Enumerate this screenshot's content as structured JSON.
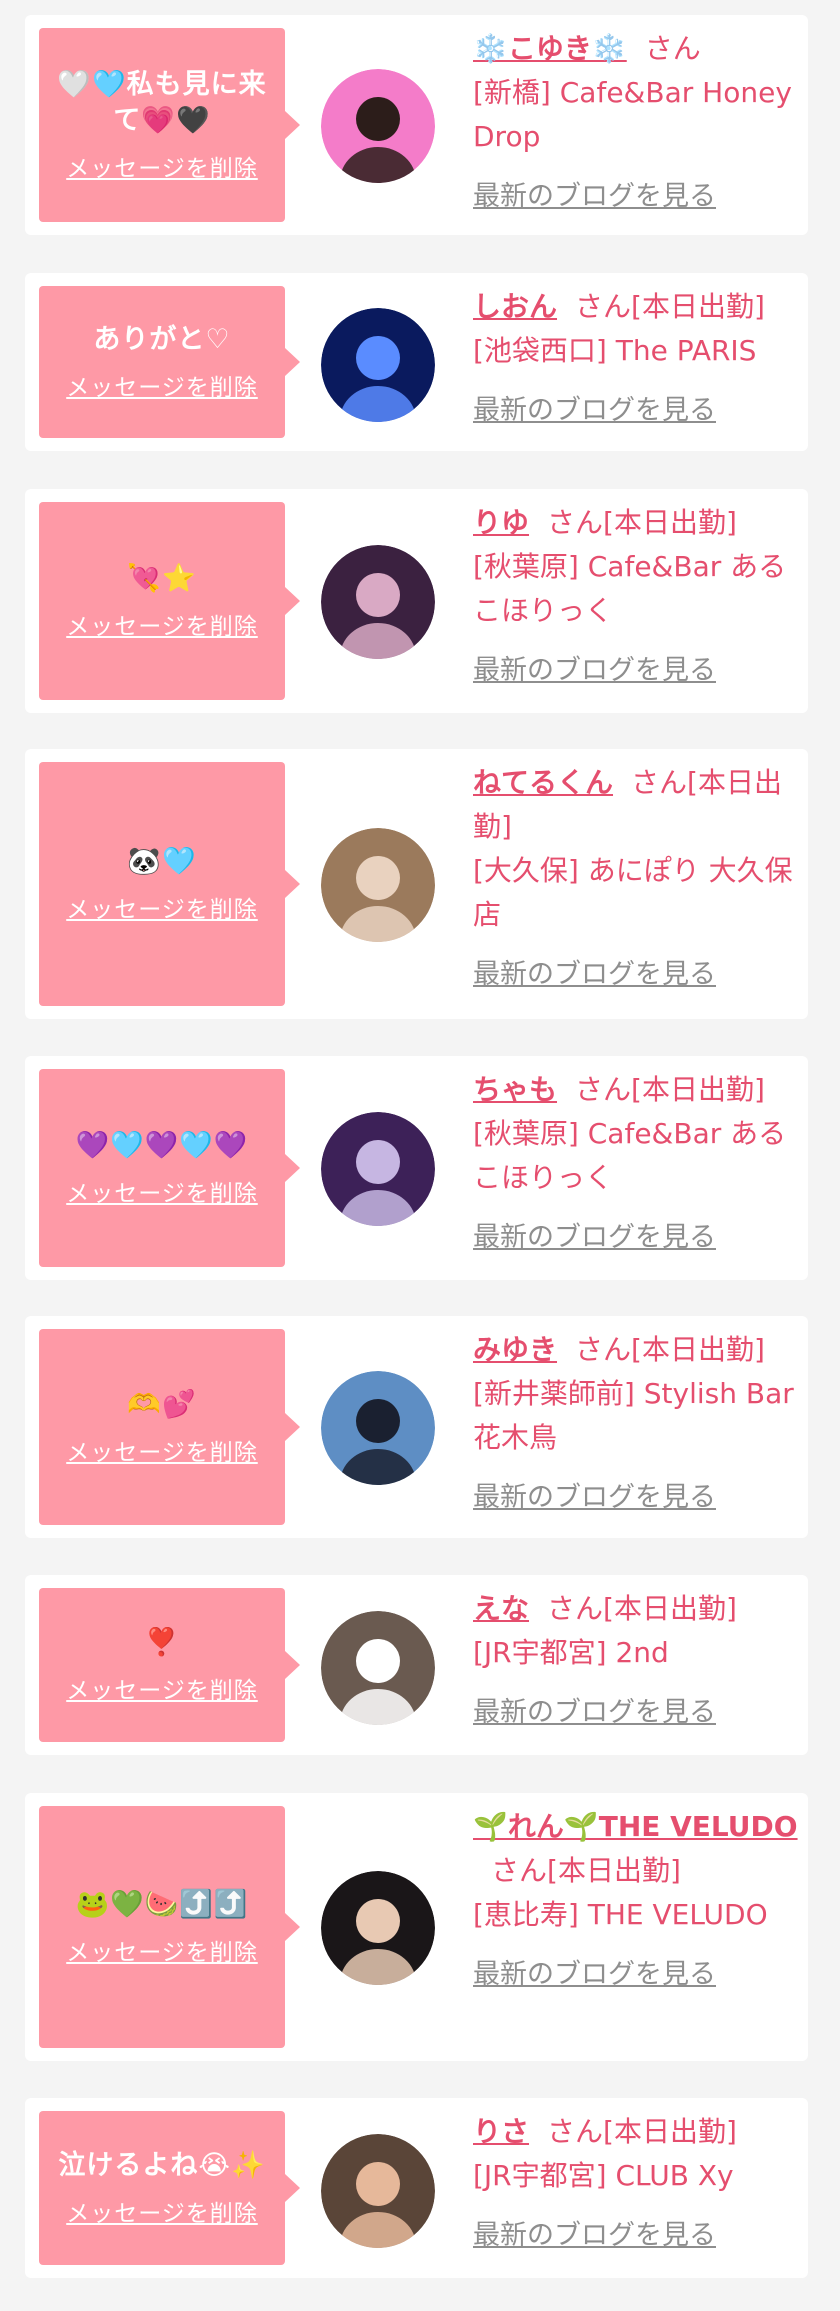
{
  "colors": {
    "page_bg": "#f4f4f4",
    "card_bg": "#ffffff",
    "bubble_bg": "#fe99a6",
    "name_pink": "#e54e6e",
    "link_gray": "#8e8e8e"
  },
  "delete_label": "メッセージを削除",
  "blog_label": "最新のブログを見る",
  "san_suffix": "さん",
  "items": [
    {
      "message": "🤍🩵私も見に来て💗🖤",
      "name": "❄️こゆき❄️",
      "status": "",
      "shop": "[新橋] Cafe&Bar Honey Drop",
      "avatar_colors": [
        "#f47cc9",
        "#2c1d1a"
      ]
    },
    {
      "message": "ありがと♡",
      "name": "しおん",
      "status": "[本日出勤]",
      "shop": "[池袋西口] The PARIS",
      "avatar_colors": [
        "#0a1a5e",
        "#5a8cff"
      ]
    },
    {
      "message": "💘⭐️",
      "name": "りゆ",
      "status": "[本日出勤]",
      "shop": "[秋葉原] Cafe&Bar あるこほりっく",
      "avatar_colors": [
        "#3b2140",
        "#d9a9c4"
      ]
    },
    {
      "message": "🐼🩵",
      "name": "ねてるくん",
      "status": "[本日出勤]",
      "shop": "[大久保] あにぽり 大久保店",
      "avatar_colors": [
        "#9b7a5c",
        "#e9d2bf"
      ]
    },
    {
      "message": "💜🩵💜🩵💜",
      "name": "ちゃも",
      "status": "[本日出勤]",
      "shop": "[秋葉原] Cafe&Bar あるこほりっく",
      "avatar_colors": [
        "#3d2158",
        "#c6b6e2"
      ]
    },
    {
      "message": "🫶💕",
      "name": "みゆき",
      "status": "[本日出勤]",
      "shop": "[新井薬師前] Stylish Bar 花木鳥",
      "avatar_colors": [
        "#5e8ec4",
        "#1a2030"
      ]
    },
    {
      "message": "❣️",
      "name": "えな",
      "status": "[本日出勤]",
      "shop": "[JR宇都宮] 2nd",
      "avatar_colors": [
        "#6a5a50",
        "#ffffff"
      ]
    },
    {
      "message": "🐸💚🍉⤴️⤴️",
      "name": "🌱れん🌱THE VELUDO",
      "status": "[本日出勤]",
      "shop": "[恵比寿] THE VELUDO",
      "avatar_colors": [
        "#1a1618",
        "#e8c9b3"
      ]
    },
    {
      "message": "泣けるよね😭✨",
      "name": "りさ",
      "status": "[本日出勤]",
      "shop": "[JR宇都宮] CLUB Xy",
      "avatar_colors": [
        "#5a4538",
        "#e6b89a"
      ]
    }
  ]
}
